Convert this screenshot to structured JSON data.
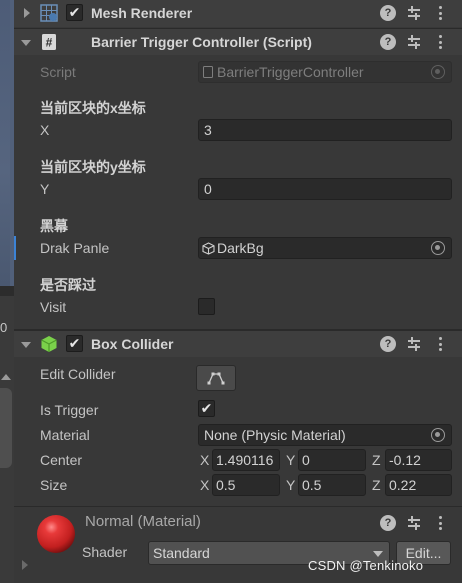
{
  "components": {
    "mesh_renderer": {
      "title": "Mesh Renderer",
      "checked": "✔"
    },
    "barrier": {
      "title": "Barrier Trigger Controller (Script)",
      "script_label": "Script",
      "script_value": "BarrierTriggerController",
      "fields": [
        {
          "header": "当前区块的x坐标",
          "label": "X",
          "value": "3"
        },
        {
          "header": "当前区块的y坐标",
          "label": "Y",
          "value": "0"
        },
        {
          "header": "黑幕",
          "label": "Drak Panle",
          "value": "DarkBg"
        },
        {
          "header": "是否踩过",
          "label": "Visit"
        }
      ]
    },
    "box_collider": {
      "title": "Box Collider",
      "checked": "✔",
      "edit_collider_label": "Edit Collider",
      "is_trigger_label": "Is Trigger",
      "is_trigger_checked": "✔",
      "material_label": "Material",
      "material_value": "None (Physic Material)",
      "center_label": "Center",
      "center": {
        "x_label": "X",
        "x": "1.490116",
        "y_label": "Y",
        "y": "0",
        "z_label": "Z",
        "z": "-0.12"
      },
      "size_label": "Size",
      "size": {
        "x_label": "X",
        "x": "0.5",
        "y_label": "Y",
        "y": "0.5",
        "z_label": "Z",
        "z": "0.22"
      }
    },
    "material": {
      "title": "Normal (Material)",
      "shader_label": "Shader",
      "shader_value": "Standard",
      "edit_label": "Edit..."
    }
  },
  "header_icons": {
    "help": "?",
    "preset": "preset-icon",
    "menu": "kebab-menu-icon"
  },
  "watermark": "CSDN @Tenkinoko",
  "left_strip_text": "0",
  "colors": {
    "selection": "#3c83d6",
    "material_ball": "#d42a2a",
    "mesh_icon": "#6a8fb8",
    "collider_icon": "#7ad14a",
    "panel_bg": "#383838"
  }
}
